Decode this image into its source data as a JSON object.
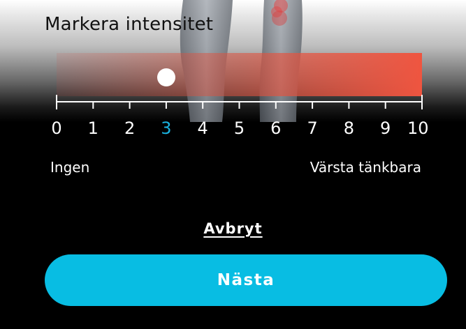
{
  "title": "Markera intensitet",
  "scale": {
    "min": 0,
    "max": 10,
    "value": 3,
    "ticks": [
      "0",
      "1",
      "2",
      "3",
      "4",
      "5",
      "6",
      "7",
      "8",
      "9",
      "10"
    ],
    "min_label": "Ingen",
    "max_label": "Värsta tänkbara"
  },
  "cancel_label": "Avbryt",
  "next_label": "Nästa",
  "colors": {
    "accent": "#08bde3",
    "selected_tick": "#1ab3e0",
    "intensity_max": "#ef5540"
  }
}
